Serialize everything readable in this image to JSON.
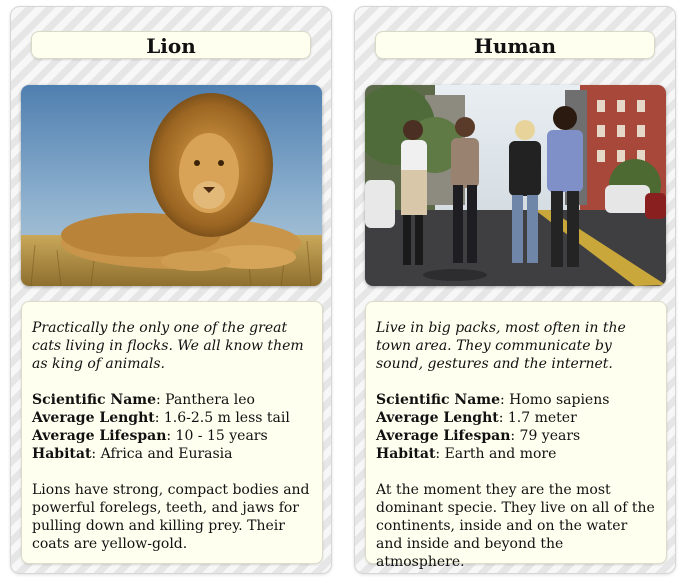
{
  "cards": [
    {
      "title": "Lion",
      "photo_subject": "lion",
      "intro": "Practically the only one of the great cats living in flocks. We all know them as king of animals.",
      "facts": [
        {
          "label": "Scientific Name",
          "value": ": Panthera leo"
        },
        {
          "label": "Average Lenght",
          "value": ": 1.6-2.5 m less tail"
        },
        {
          "label": "Average Lifespan",
          "value": ": 10 - 15 years"
        },
        {
          "label": "Habitat",
          "value": ": Africa and Eurasia"
        }
      ],
      "description": "Lions have strong, compact bodies and powerful forelegs, teeth, and jaws for pulling down and killing prey. Their coats are yellow-gold."
    },
    {
      "title": "Human",
      "photo_subject": "people-walking-city-street",
      "intro": "Live in big packs, most often in the town area. They communicate by sound, gestures and the internet.",
      "facts": [
        {
          "label": "Scientific Name",
          "value": ": Homo sapiens"
        },
        {
          "label": "Average Lenght",
          "value": ": 1.7 meter"
        },
        {
          "label": "Average Lifespan",
          "value": ": 79 years"
        },
        {
          "label": "Habitat",
          "value": ": Earth and more"
        }
      ],
      "description": "At the moment they are the most dominant specie. They live on all of the continents, inside and on the water and inside and beyond the atmosphere."
    }
  ],
  "colors": {
    "box_background": "#fffff0",
    "stripe_light": "#f7f7f7",
    "stripe_dark": "#e6e6e6",
    "text": "#111111"
  }
}
